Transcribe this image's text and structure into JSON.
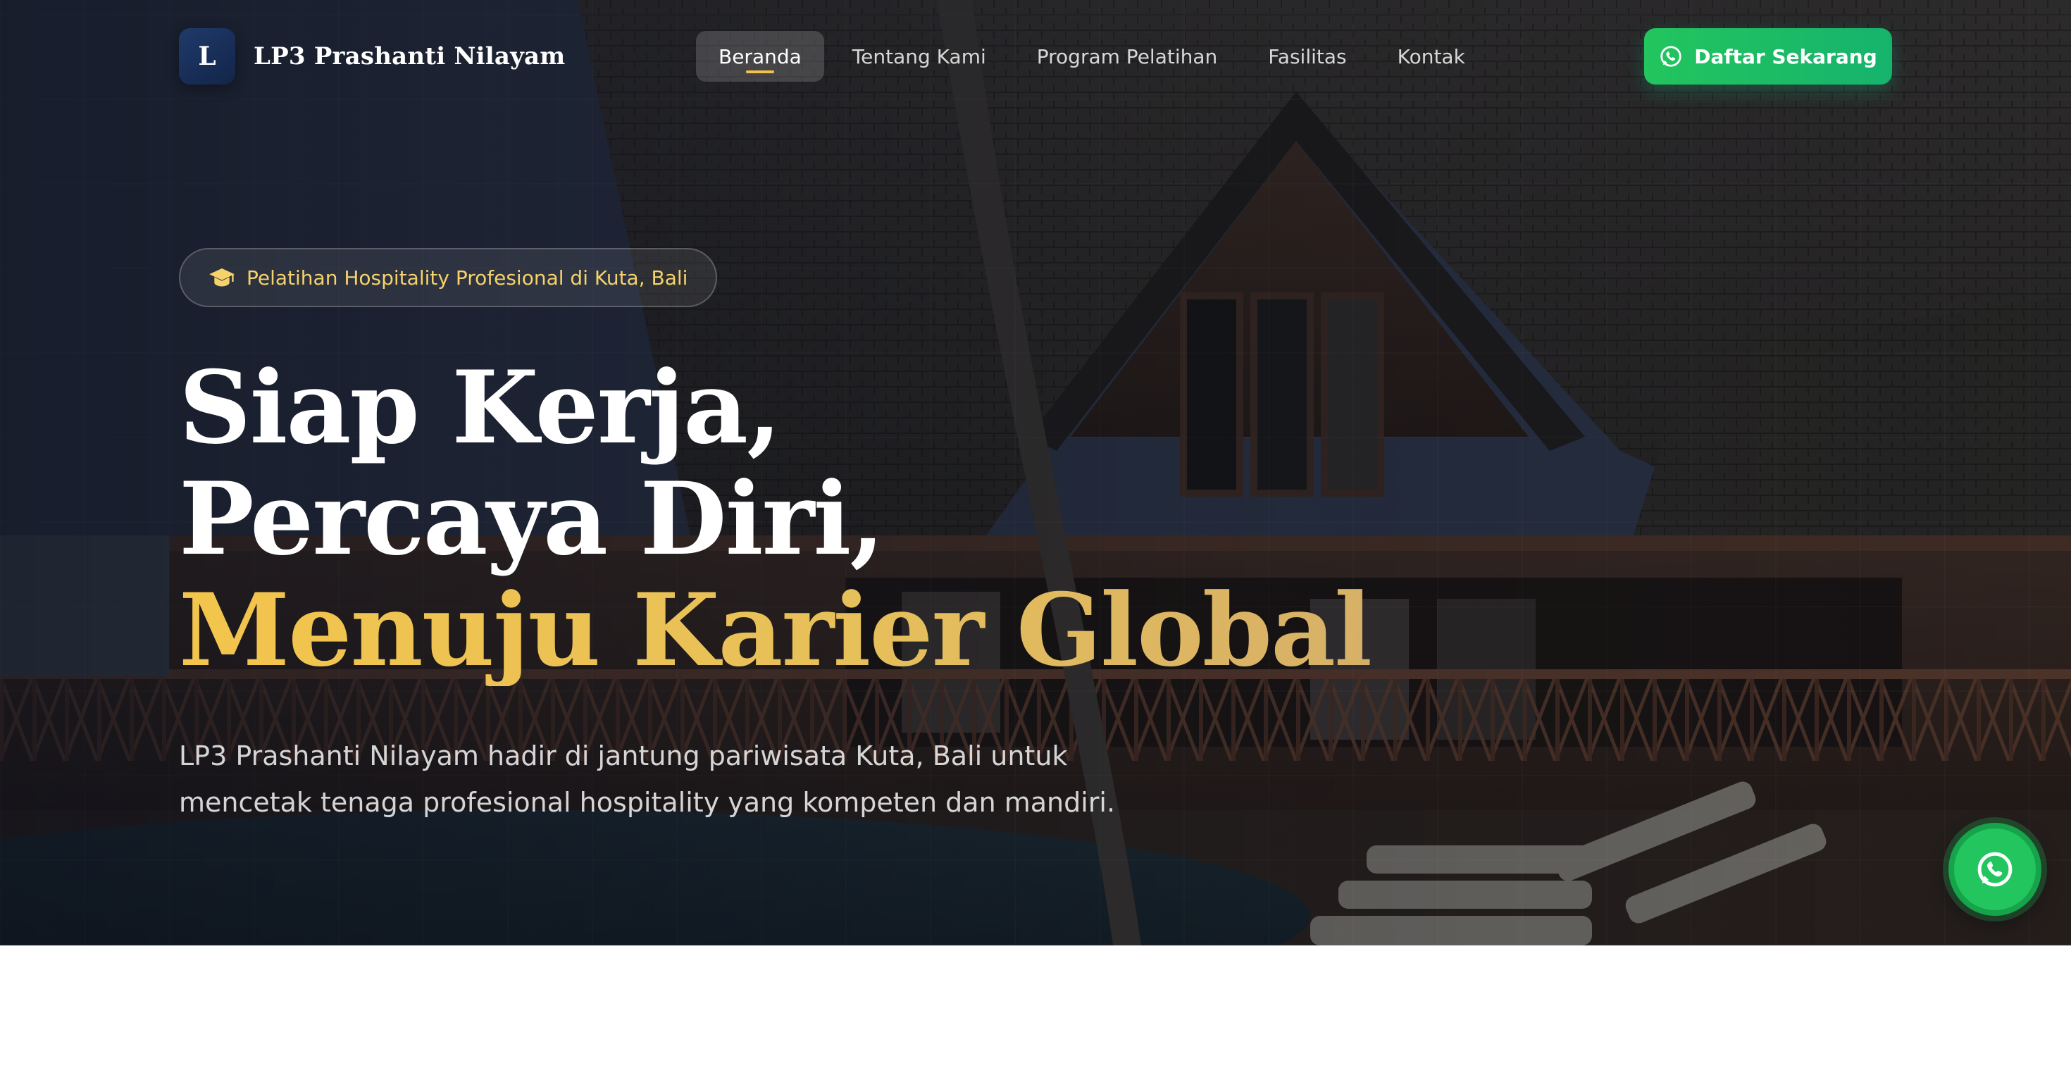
{
  "brand": {
    "logo_letter": "L",
    "name": "LP3 Prashanti Nilayam"
  },
  "nav": {
    "items": [
      {
        "label": "Beranda",
        "active": true
      },
      {
        "label": "Tentang Kami",
        "active": false
      },
      {
        "label": "Program Pelatihan",
        "active": false
      },
      {
        "label": "Fasilitas",
        "active": false
      },
      {
        "label": "Kontak",
        "active": false
      }
    ],
    "cta": {
      "label": "Daftar Sekarang",
      "icon": "whatsapp-icon"
    }
  },
  "hero": {
    "badge": {
      "icon": "graduation-cap-icon",
      "text": "Pelatihan Hospitality Profesional di Kuta, Bali"
    },
    "headline": {
      "line1": "Siap Kerja,",
      "line2": "Percaya Diri,",
      "line3": "Menuju Karier Global."
    },
    "lead": "LP3 Prashanti Nilayam hadir di jantung pariwisata Kuta, Bali untuk mencetak tenaga profesional hospitality yang kompeten dan mandiri.",
    "background": "resort-villa-photo"
  },
  "floating_button": {
    "icon": "whatsapp-icon"
  },
  "colors": {
    "accent_gold": "#f3c54c",
    "whatsapp_green": "#22c55e",
    "logo_navy": "#1f3a6b",
    "text_white": "#ffffff"
  }
}
